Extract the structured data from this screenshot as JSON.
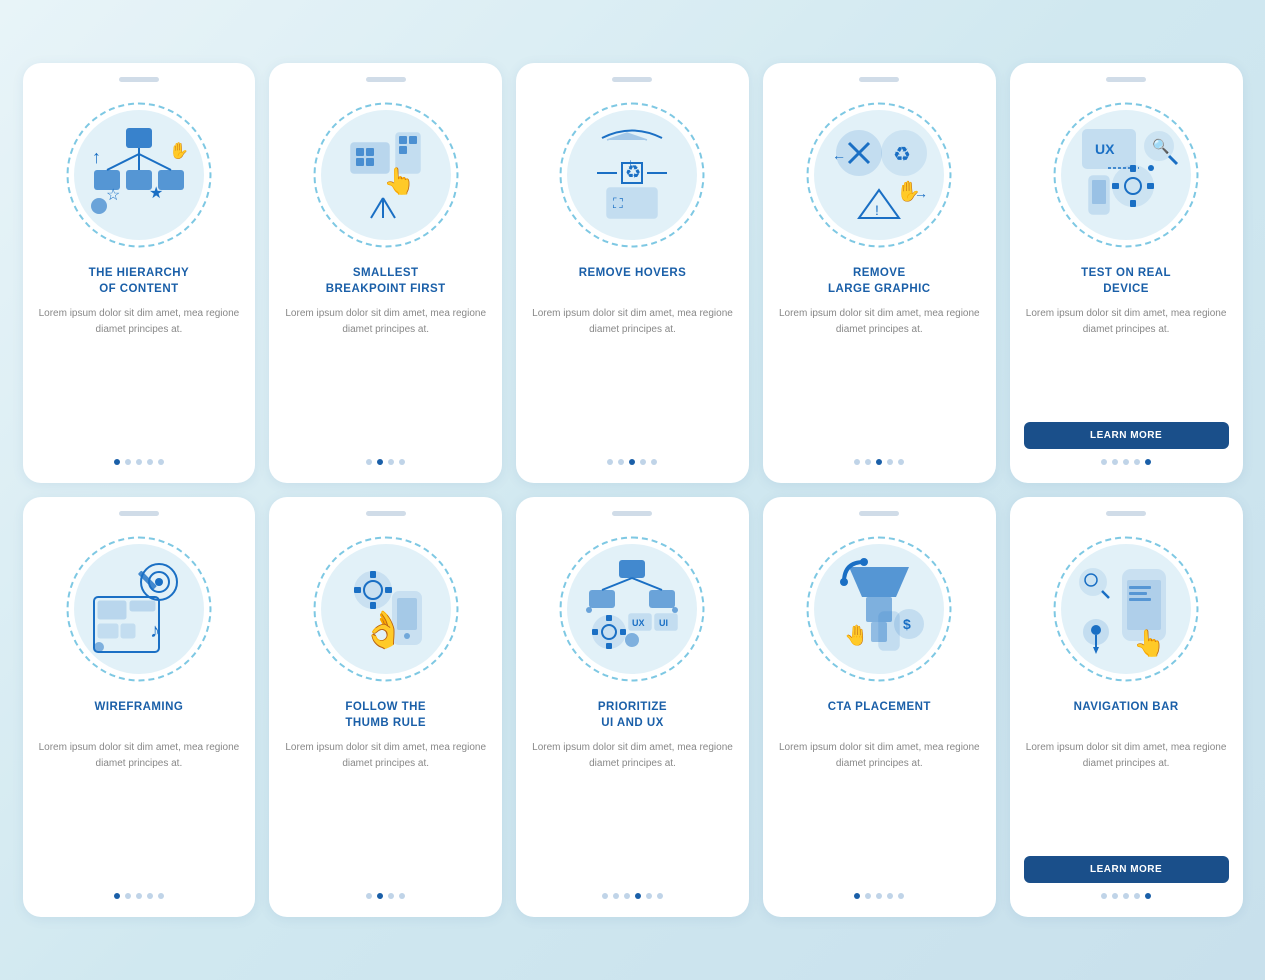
{
  "cards": [
    {
      "id": "hierarchy",
      "title": "THE HIERARCHY\nOF CONTENT",
      "body": "Lorem ipsum dolor sit dim amet, mea regione diamet principes at.",
      "dots": [
        true,
        false,
        false,
        false,
        false
      ],
      "showLearnMore": false,
      "icon": "hierarchy"
    },
    {
      "id": "breakpoint",
      "title": "SMALLEST\nBREAKPOINT FIRST",
      "body": "Lorem ipsum dolor sit dim amet, mea regione diamet principes at.",
      "dots": [
        false,
        true,
        false,
        false
      ],
      "showLearnMore": false,
      "icon": "breakpoint"
    },
    {
      "id": "hovers",
      "title": "REMOVE HOVERS",
      "body": "Lorem ipsum dolor sit dim amet, mea regione diamet principes at.",
      "dots": [
        false,
        false,
        true,
        false,
        false
      ],
      "showLearnMore": false,
      "icon": "hovers"
    },
    {
      "id": "graphic",
      "title": "REMOVE\nLARGE GRAPHIC",
      "body": "Lorem ipsum dolor sit dim amet, mea regione diamet principes at.",
      "dots": [
        false,
        false,
        true,
        false,
        false
      ],
      "showLearnMore": false,
      "icon": "graphic"
    },
    {
      "id": "device",
      "title": "TEST ON REAL\nDEVICE",
      "body": "Lorem ipsum dolor sit dim amet, mea regione diamet principes at.",
      "dots": [
        false,
        false,
        false,
        false,
        true
      ],
      "showLearnMore": true,
      "learnMoreLabel": "LEARN MORE",
      "icon": "device"
    },
    {
      "id": "wireframing",
      "title": "WIREFRAMING",
      "body": "Lorem ipsum dolor sit dim amet, mea regione diamet principes at.",
      "dots": [
        true,
        false,
        false,
        false,
        false
      ],
      "showLearnMore": false,
      "icon": "wireframing"
    },
    {
      "id": "thumb",
      "title": "FOLLOW THE\nTHUMB RULE",
      "body": "Lorem ipsum dolor sit dim amet, mea regione diamet principes at.",
      "dots": [
        false,
        true,
        false,
        false
      ],
      "showLearnMore": false,
      "icon": "thumb"
    },
    {
      "id": "uiux",
      "title": "PRIORITIZE\nUI AND UX",
      "body": "Lorem ipsum dolor sit dim amet, mea regione diamet principes at.",
      "dots": [
        false,
        false,
        false,
        true,
        false,
        false
      ],
      "showLearnMore": false,
      "icon": "uiux"
    },
    {
      "id": "cta",
      "title": "CTA PLACEMENT",
      "body": "Lorem ipsum dolor sit dim amet, mea regione diamet principes at.",
      "dots": [
        true,
        false,
        false,
        false,
        false
      ],
      "showLearnMore": false,
      "icon": "cta"
    },
    {
      "id": "navbar",
      "title": "NAVIGATION BAR",
      "body": "Lorem ipsum dolor sit dim amet, mea regione diamet principes at.",
      "dots": [
        false,
        false,
        false,
        false,
        true
      ],
      "showLearnMore": true,
      "learnMoreLabel": "LEARN MORE",
      "icon": "navbar"
    }
  ]
}
